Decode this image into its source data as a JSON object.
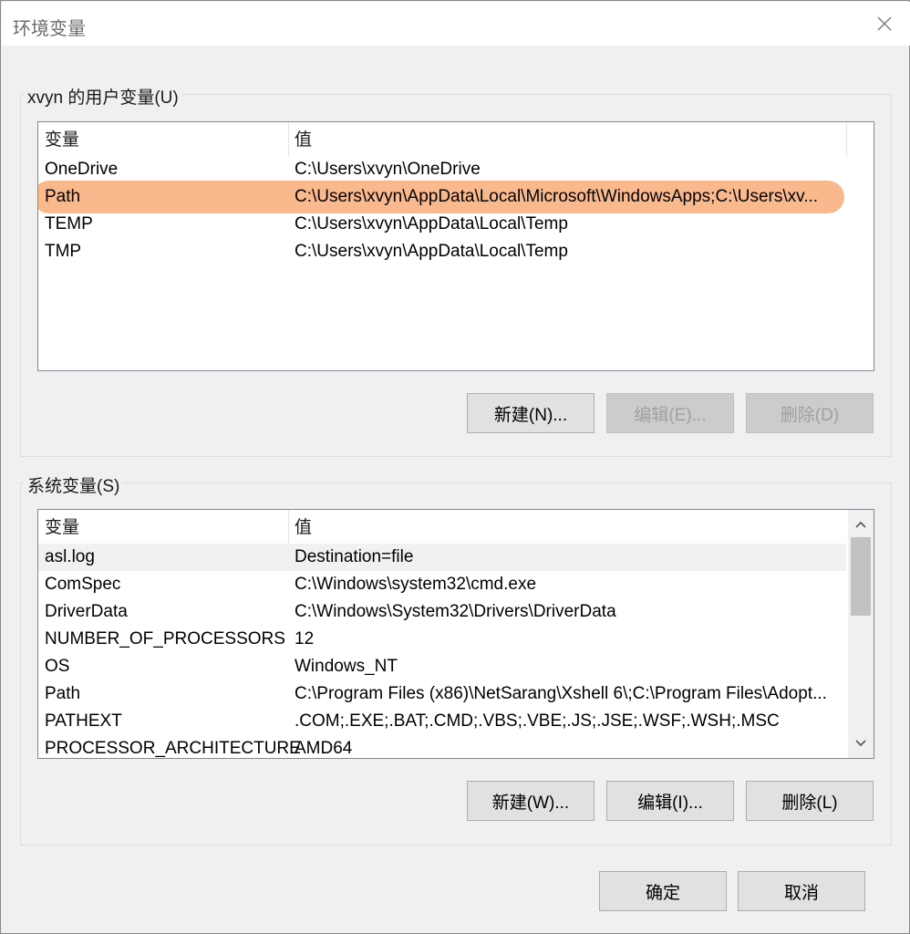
{
  "window": {
    "title": "环境变量"
  },
  "user_vars": {
    "legend": "xvyn 的用户变量(U)",
    "col_name": "变量",
    "col_value": "值",
    "rows": [
      {
        "name": "OneDrive",
        "value": "C:\\Users\\xvyn\\OneDrive"
      },
      {
        "name": "Path",
        "value": "C:\\Users\\xvyn\\AppData\\Local\\Microsoft\\WindowsApps;C:\\Users\\xv..."
      },
      {
        "name": "TEMP",
        "value": "C:\\Users\\xvyn\\AppData\\Local\\Temp"
      },
      {
        "name": "TMP",
        "value": "C:\\Users\\xvyn\\AppData\\Local\\Temp"
      }
    ],
    "highlighted_row": "Path",
    "highlight_color": "#fab98c",
    "new_label": "新建(N)...",
    "edit_label": "编辑(E)...",
    "delete_label": "删除(D)"
  },
  "system_vars": {
    "legend": "系统变量(S)",
    "col_name": "变量",
    "col_value": "值",
    "rows": [
      {
        "name": "asl.log",
        "value": "Destination=file"
      },
      {
        "name": "ComSpec",
        "value": "C:\\Windows\\system32\\cmd.exe"
      },
      {
        "name": "DriverData",
        "value": "C:\\Windows\\System32\\Drivers\\DriverData"
      },
      {
        "name": "NUMBER_OF_PROCESSORS",
        "value": "12"
      },
      {
        "name": "OS",
        "value": "Windows_NT"
      },
      {
        "name": "Path",
        "value": "C:\\Program Files (x86)\\NetSarang\\Xshell 6\\;C:\\Program Files\\Adopt..."
      },
      {
        "name": "PATHEXT",
        "value": ".COM;.EXE;.BAT;.CMD;.VBS;.VBE;.JS;.JSE;.WSF;.WSH;.MSC"
      },
      {
        "name": "PROCESSOR_ARCHITECTURE",
        "value": "AMD64"
      }
    ],
    "selected_row": "asl.log",
    "new_label": "新建(W)...",
    "edit_label": "编辑(I)...",
    "delete_label": "删除(L)"
  },
  "footer": {
    "ok_label": "确定",
    "cancel_label": "取消"
  },
  "icons": {
    "close": "close-icon",
    "scroll_up": "chevron-up-icon",
    "scroll_down": "chevron-down-icon"
  }
}
